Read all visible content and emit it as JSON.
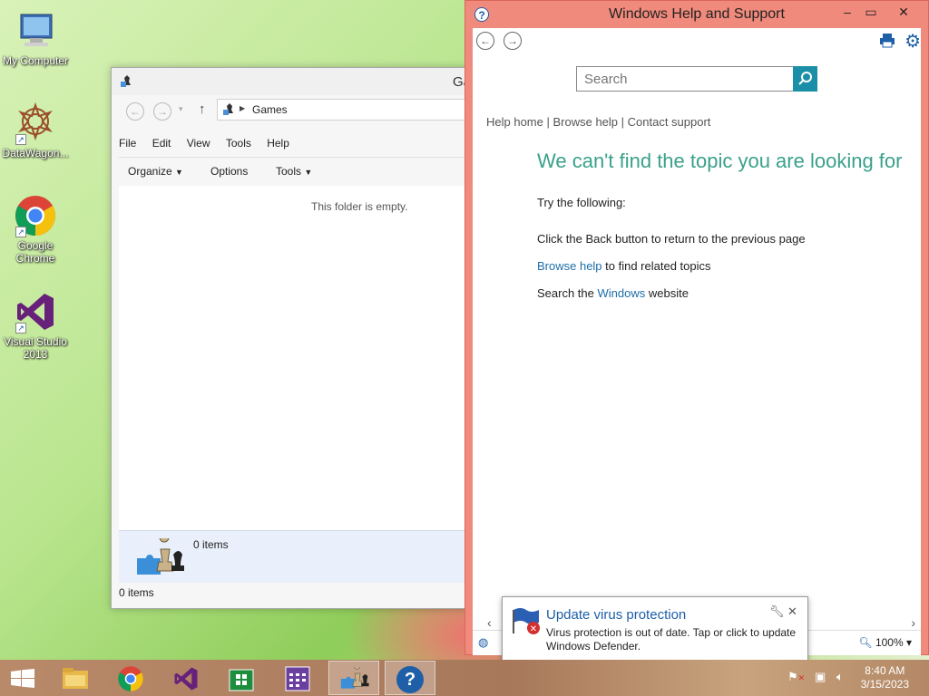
{
  "desktop": {
    "icons": [
      {
        "label": "My Computer"
      },
      {
        "label": "DataWagon..."
      },
      {
        "label": "Google Chrome"
      },
      {
        "label": "Visual Studio 2013"
      }
    ]
  },
  "explorer": {
    "title": "Ga",
    "address": "Games",
    "menu": [
      "File",
      "Edit",
      "View",
      "Tools",
      "Help"
    ],
    "commands": [
      "Organize",
      "Options",
      "Tools"
    ],
    "empty_message": "This folder is empty.",
    "details_count": "0 items",
    "status": "0 items"
  },
  "help": {
    "title": "Windows Help and Support",
    "search_placeholder": "Search",
    "links": {
      "home": "Help home",
      "browse": "Browse help",
      "contact": "Contact support"
    },
    "heading": "We can't find the topic you are looking for",
    "try_following": "Try the following:",
    "tip1": "Click the Back button to return to the previous page",
    "tip2_link": "Browse help",
    "tip2_rest": " to find related topics",
    "tip3_pre": "Search the ",
    "tip3_link": "Windows",
    "tip3_rest": " website",
    "zoom": "100%"
  },
  "toast": {
    "title": "Update virus protection",
    "body": "Virus protection is out of date. Tap or click to update Windows Defender."
  },
  "taskbar": {
    "time": "8:40 AM",
    "date": "3/15/2023"
  },
  "colors": {
    "help_frame": "#f08a7c",
    "accent_teal": "#3aa18a",
    "link_blue": "#1d6ea8",
    "search_button": "#1b8fa8"
  }
}
